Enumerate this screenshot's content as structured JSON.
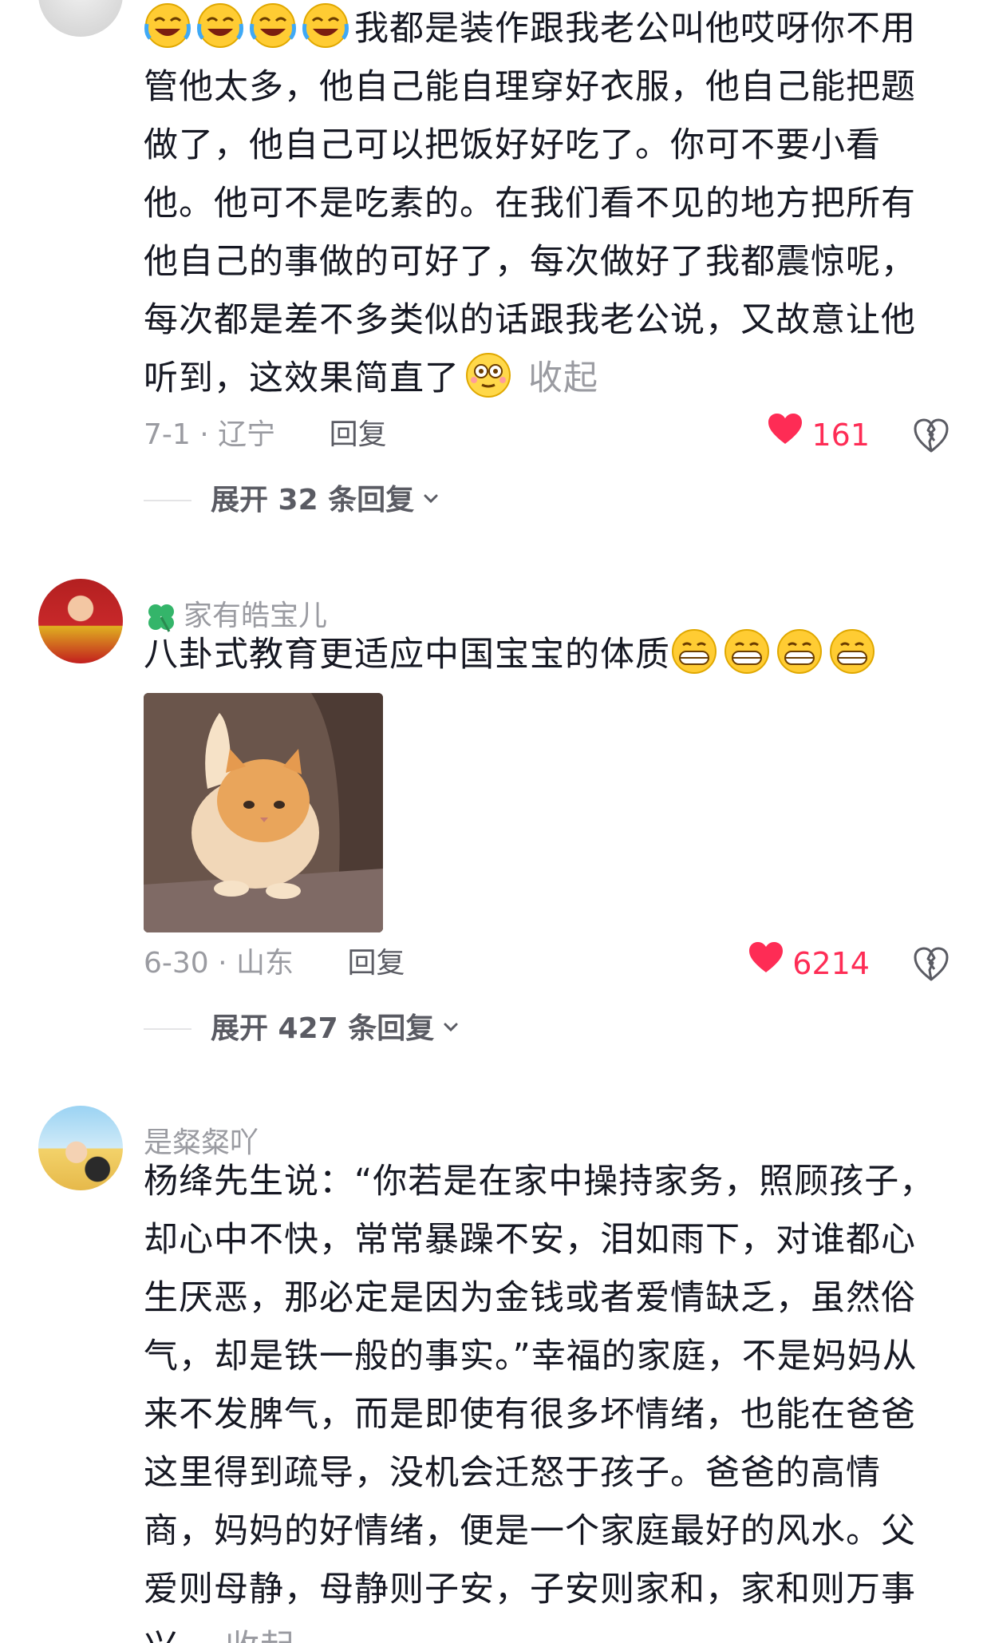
{
  "comments": [
    {
      "avatar_icon": "avatar-icon",
      "text": "我都是装作跟我老公叫他哎呀你不用管他太多，他自己能自理穿好衣服，他自己能把题做了，他自己可以把饭好好吃了。你可不要小看他。他可不是吃素的。在我们看不见的地方把所有他自己的事做的可好了，每次做好了我都震惊呢，每次都是差不多类似的话跟我老公说，又故意让他听到，这效果简直了",
      "leading_emojis": [
        "laughing-crying-emoji",
        "laughing-crying-emoji",
        "laughing-crying-emoji",
        "laughing-crying-emoji"
      ],
      "trailing_emoji": "dazed-emoji",
      "collapse_label": "收起",
      "time_location": "7-1 · 辽宁",
      "reply_label": "回复",
      "likes": "161",
      "expand_label": "展开 32 条回复"
    },
    {
      "username": "家有皓宝儿",
      "username_icon": "clover-icon",
      "text": "八卦式教育更适应中国宝宝的体质",
      "trailing_emojis": [
        "grinning-emoji",
        "grinning-emoji",
        "grinning-emoji",
        "grinning-emoji"
      ],
      "image_icon": "cat-image",
      "time_location": "6-30 · 山东",
      "reply_label": "回复",
      "likes": "6214",
      "expand_label": "展开 427 条回复"
    },
    {
      "username": "是粲粲吖",
      "text": "杨绛先生说：“你若是在家中操持家务，照顾孩子，却心中不快，常常暴躁不安，泪如雨下，对谁都心生厌恶，那必定是因为金钱或者爱情缺乏，虽然俗气，却是铁一般的事实。”幸福的家庭，不是妈妈从来不发脾气，而是即使有很多坏情绪，也能在爸爸这里得到疏导，没机会迁怒于孩子。爸爸的高情商，妈妈的好情绪，便是一个家庭最好的风水。父爱则母静，母静则子安，子安则家和，家和则万事兴。",
      "collapse_label": "收起"
    }
  ],
  "colors": {
    "like_red": "#fe2c55",
    "muted_gray": "#9a9ba1",
    "text_dark": "#161823"
  }
}
